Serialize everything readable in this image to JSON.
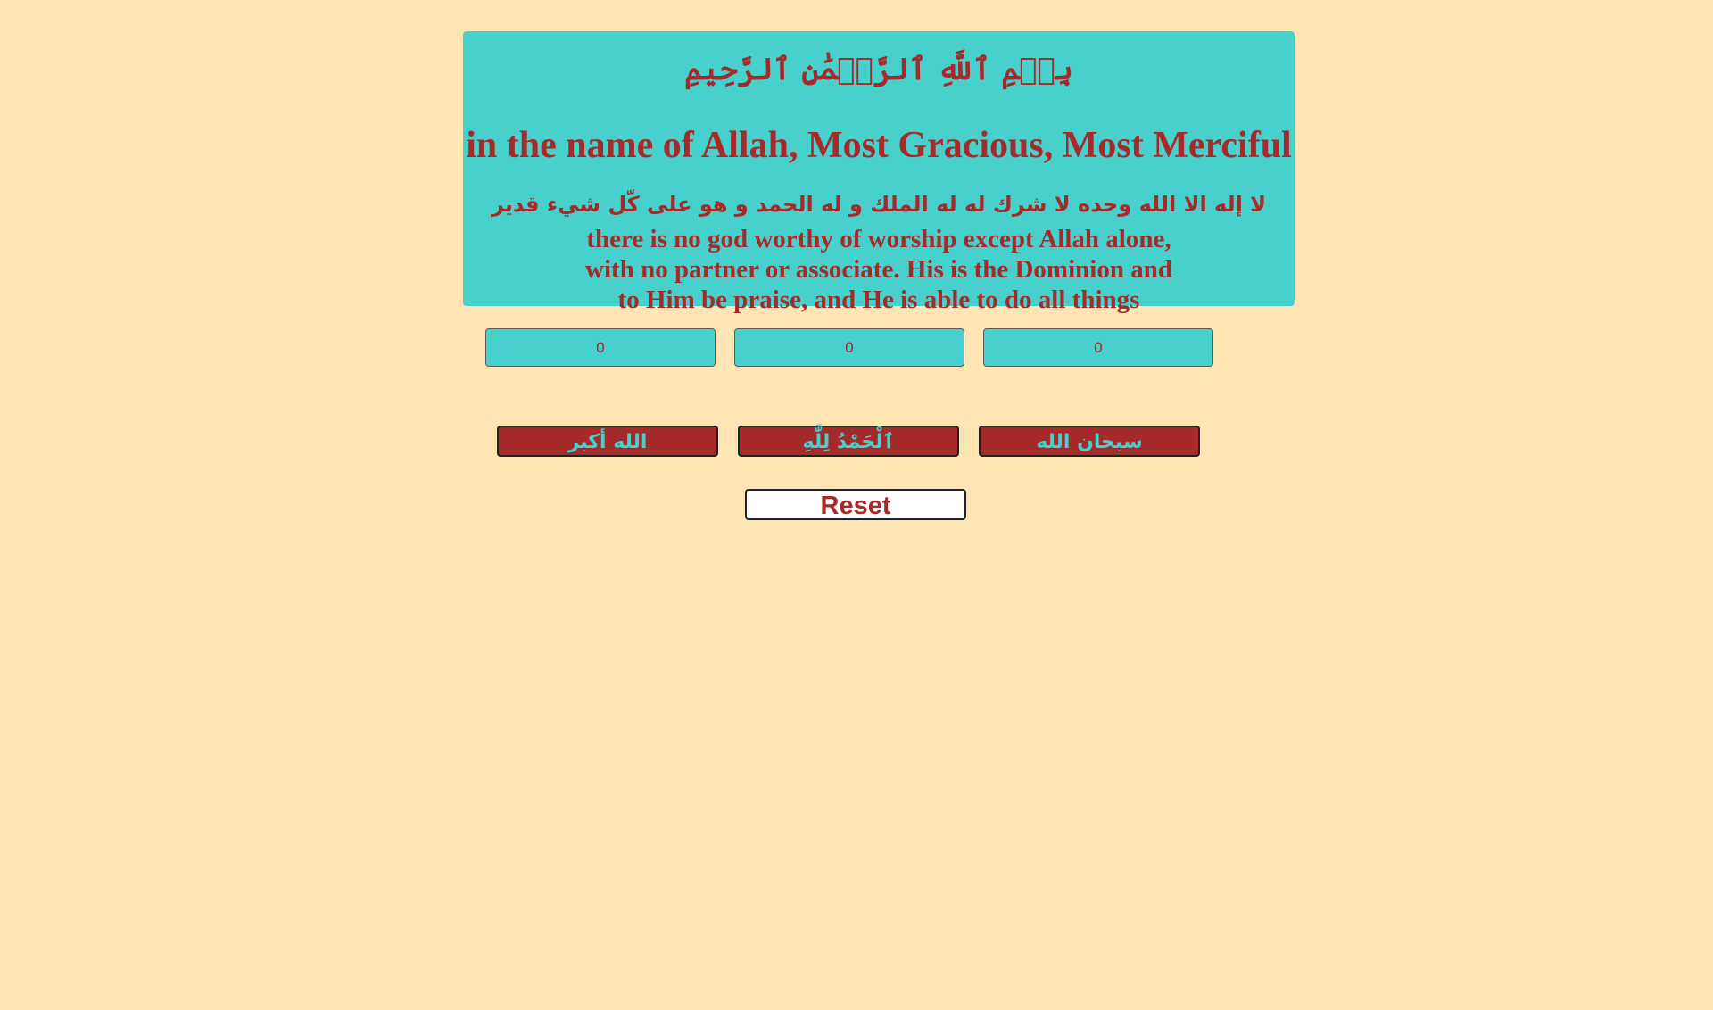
{
  "colors": {
    "background": "#ffe5b4",
    "accent": "#48d1cc",
    "text": "#a52a2a",
    "button_bg": "#a52a2a",
    "reset_bg": "#ffffff"
  },
  "header": {
    "bismillah_arabic": "بِسۡمِ ٱللَّهِ ٱلرَّحۡمَٰنِ ٱلرَّحِيمِ",
    "bismillah_english": "in the name of Allah, Most Gracious, Most Merciful",
    "tahlil_arabic": "لا إله الا الله وحده لا شرك له له الملك و له الحمد و هو على كّل شيء قدير",
    "tahlil_english_lines": [
      "there is no god worthy of worship except Allah alone,",
      "with no partner or associate. His is the Dominion and",
      "to Him be praise, and He is able to do all things"
    ]
  },
  "counters": [
    {
      "value": "0"
    },
    {
      "value": "0"
    },
    {
      "value": "0"
    }
  ],
  "buttons": [
    {
      "label": "الله أكبر"
    },
    {
      "label": "ٱلْحَمْدُ لِلَّٰهِ"
    },
    {
      "label": "سبحان الله"
    }
  ],
  "reset": {
    "label": "Reset"
  }
}
